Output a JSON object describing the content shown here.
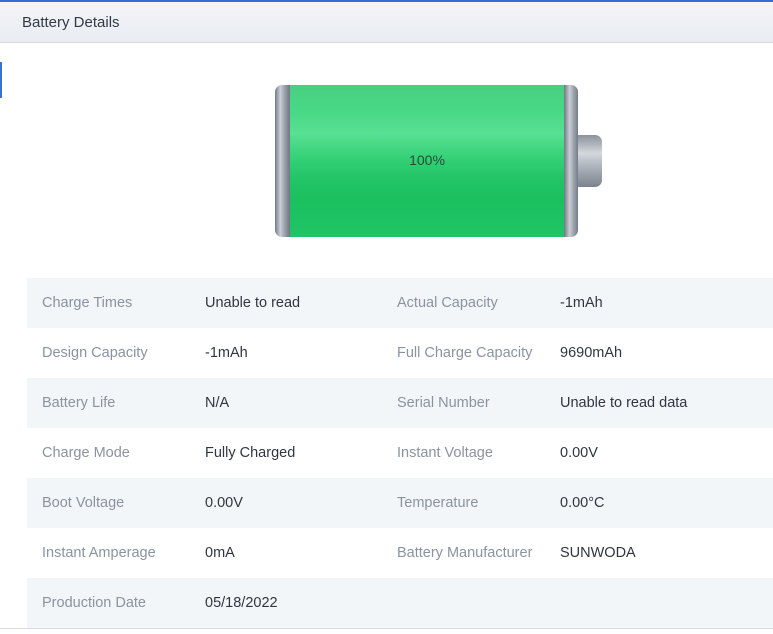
{
  "header": {
    "title": "Battery Details"
  },
  "battery": {
    "percent_label": "100%",
    "level": 1.0,
    "fill_color": "#1fc565"
  },
  "details": {
    "rows": [
      {
        "label1": "Charge Times",
        "value1": "Unable to read",
        "label2": "Actual Capacity",
        "value2": "-1mAh"
      },
      {
        "label1": "Design Capacity",
        "value1": "-1mAh",
        "label2": "Full Charge Capacity",
        "value2": "9690mAh"
      },
      {
        "label1": "Battery Life",
        "value1": "N/A",
        "label2": "Serial Number",
        "value2": "Unable to read data"
      },
      {
        "label1": "Charge Mode",
        "value1": "Fully Charged",
        "label2": "Instant Voltage",
        "value2": "0.00V"
      },
      {
        "label1": "Boot Voltage",
        "value1": "0.00V",
        "label2": "Temperature",
        "value2": "0.00°C"
      },
      {
        "label1": "Instant Amperage",
        "value1": "0mA",
        "label2": "Battery Manufacturer",
        "value2": "SUNWODA"
      },
      {
        "label1": "Production Date",
        "value1": "05/18/2022",
        "label2": "",
        "value2": ""
      }
    ]
  }
}
